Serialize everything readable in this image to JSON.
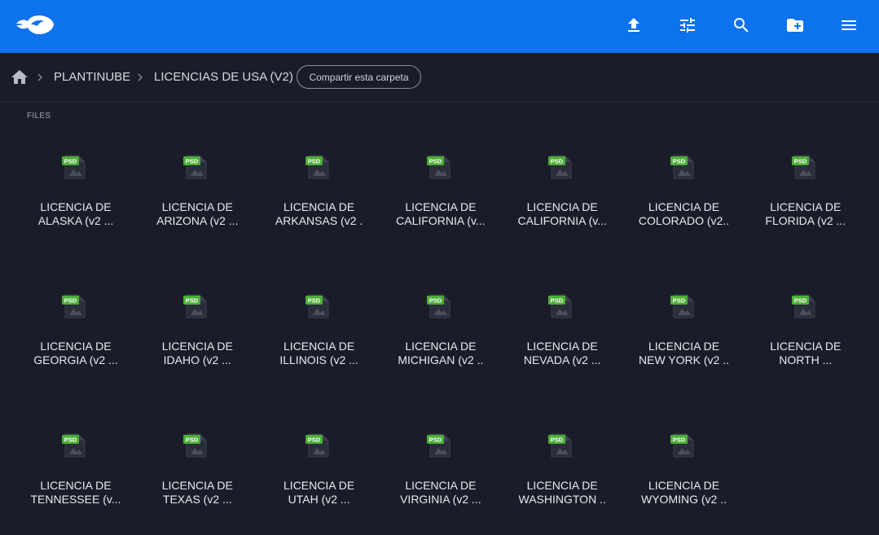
{
  "colors": {
    "brand": "#0d72ee",
    "background": "#1a1d29",
    "psd_badge": "#4caf35"
  },
  "toolbar": {
    "logo_icon": "mega-fish-logo",
    "buttons": [
      {
        "name": "upload-icon"
      },
      {
        "name": "filter-sliders-icon"
      },
      {
        "name": "search-icon"
      },
      {
        "name": "new-folder-icon"
      },
      {
        "name": "menu-icon"
      }
    ]
  },
  "breadcrumb": {
    "home_icon": "home-icon",
    "items": [
      "PLANTINUBE",
      "LICENCIAS DE USA (V2)"
    ],
    "share_label": "Compartir esta carpeta"
  },
  "files_section": {
    "label": "FILES",
    "badge": "PSD",
    "files": [
      {
        "line1": "LICENCIA DE",
        "line2": "ALASKA (v2 ..."
      },
      {
        "line1": "LICENCIA DE",
        "line2": "ARIZONA (v2 ..."
      },
      {
        "line1": "LICENCIA DE",
        "line2": "ARKANSAS (v2 ."
      },
      {
        "line1": "LICENCIA DE",
        "line2": "CALIFORNIA (v..."
      },
      {
        "line1": "LICENCIA DE",
        "line2": "CALIFORNIA (v..."
      },
      {
        "line1": "LICENCIA DE",
        "line2": "COLORADO (v2.."
      },
      {
        "line1": "LICENCIA DE",
        "line2": "FLORIDA (v2 ..."
      },
      {
        "line1": "LICENCIA DE",
        "line2": "GEORGIA (v2 ..."
      },
      {
        "line1": "LICENCIA DE",
        "line2": "IDAHO (v2 ..."
      },
      {
        "line1": "LICENCIA DE",
        "line2": "ILLINOIS (v2 ..."
      },
      {
        "line1": "LICENCIA DE",
        "line2": "MICHIGAN (v2 .."
      },
      {
        "line1": "LICENCIA DE",
        "line2": "NEVADA (v2 ..."
      },
      {
        "line1": "LICENCIA DE",
        "line2": "NEW YORK (v2 .."
      },
      {
        "line1": "LICENCIA DE",
        "line2": "NORTH ..."
      },
      {
        "line1": "LICENCIA DE",
        "line2": "TENNESSEE (v..."
      },
      {
        "line1": "LICENCIA DE",
        "line2": "TEXAS (v2 ..."
      },
      {
        "line1": "LICENCIA DE",
        "line2": "UTAH (v2 ..."
      },
      {
        "line1": "LICENCIA DE",
        "line2": "VIRGINIA (v2 ..."
      },
      {
        "line1": "LICENCIA DE",
        "line2": "WASHINGTON .."
      },
      {
        "line1": "LICENCIA DE",
        "line2": "WYOMING (v2 .."
      }
    ]
  }
}
